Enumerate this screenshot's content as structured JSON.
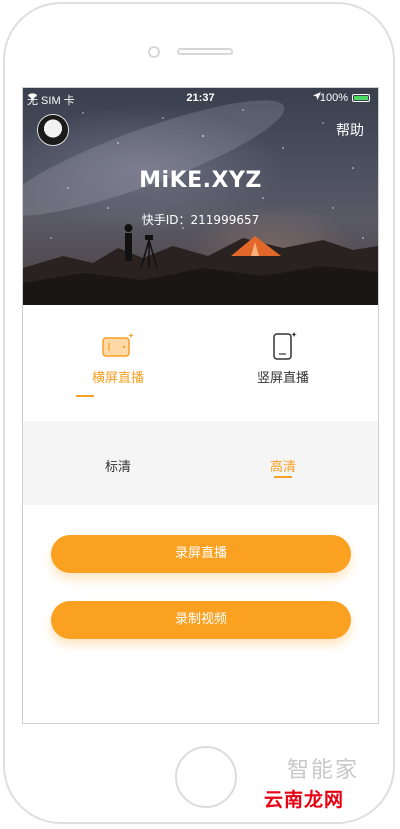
{
  "status_bar": {
    "carrier": "无 SIM 卡",
    "time": "21:37",
    "battery": "100%",
    "battery_level": 1.0
  },
  "header": {
    "nickname": "MiKE.XYZ",
    "user_id": "快手ID：211999657",
    "help_label": "帮助"
  },
  "modes": {
    "landscape_label": "横屏直播",
    "portrait_label": "竖屏直播",
    "selected": "landscape"
  },
  "quality": {
    "sd_label": "标清",
    "hd_label": "高清",
    "selected": "hd"
  },
  "actions": {
    "record_screen_live": "录屏直播",
    "record_video": "录制视频"
  },
  "colors": {
    "accent": "#f5a024",
    "button": "#fba121"
  },
  "watermark": {
    "logo": "云南龙网",
    "text": "智能家"
  }
}
